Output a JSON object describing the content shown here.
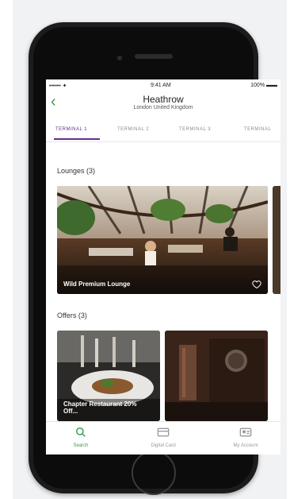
{
  "status_bar": {
    "carrier": "•••••• ✦",
    "time": "9:41 AM",
    "battery": "100% ▬▬"
  },
  "header": {
    "back": "‹",
    "title": "Heathrow",
    "subtitle": "London United Kingdom"
  },
  "tabs": [
    {
      "label": "TERMINAL 1",
      "active": true
    },
    {
      "label": "TERMINAL 2",
      "active": false
    },
    {
      "label": "TERMINAL 3",
      "active": false
    },
    {
      "label": "TERMINAL",
      "active": false
    }
  ],
  "sections": {
    "lounges": {
      "title": "Lounges (3)",
      "cards": [
        {
          "caption": "Wild Premium Lounge"
        }
      ]
    },
    "offers": {
      "title": "Offers (3)",
      "cards": [
        {
          "caption": "Chapter Restaurant 20% Off..."
        },
        {
          "caption": ""
        }
      ]
    }
  },
  "bottom_nav": [
    {
      "label": "Search",
      "icon": "search-icon",
      "active": true
    },
    {
      "label": "Digital Card",
      "icon": "card-icon",
      "active": false
    },
    {
      "label": "My Account",
      "icon": "account-icon",
      "active": false
    }
  ],
  "colors": {
    "accent_green": "#3a9a50",
    "accent_purple": "#6a2e8a"
  }
}
